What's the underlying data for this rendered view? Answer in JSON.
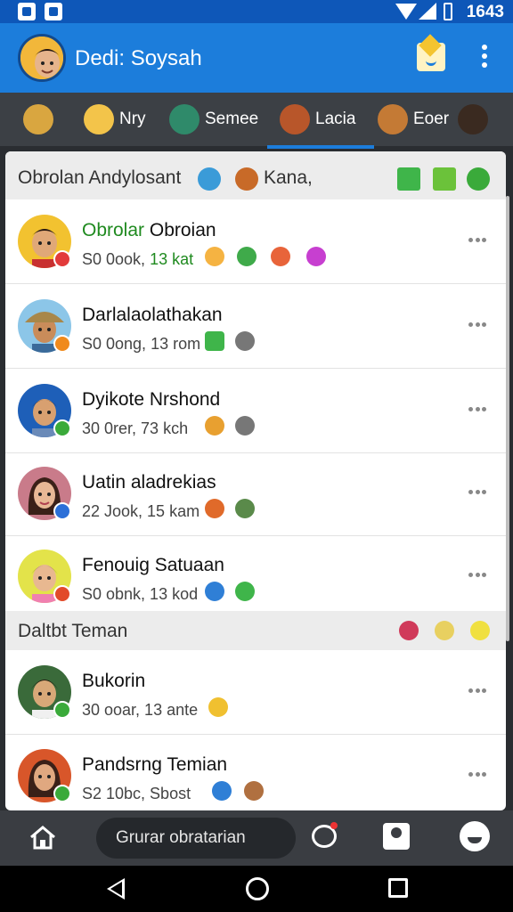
{
  "status_bar": {
    "time": "1643"
  },
  "app_bar": {
    "title": "Dedi: Soysah"
  },
  "stories": [
    {
      "label": "",
      "avatar_color": "#d9a640"
    },
    {
      "label": "Nry",
      "avatar_color": "#f3c44a"
    },
    {
      "label": "Semee",
      "avatar_color": "#2f8a6a"
    },
    {
      "label": "Lacia",
      "avatar_color": "#b8562a"
    },
    {
      "label": "Eoer",
      "avatar_color": "#c47a35"
    },
    {
      "label": "",
      "avatar_color": "#3a2a20"
    }
  ],
  "sections": [
    {
      "title": "Obrolan Andylosant",
      "extra": "Kana,",
      "emoji": [
        "globe-icon",
        "basketball-icon",
        "map-icon",
        "ticket-icon",
        "check-icon"
      ]
    },
    {
      "title": "Daltbt Teman",
      "emoji": [
        "ball-icon",
        "star-icon",
        "ghost-icon"
      ]
    }
  ],
  "chats": [
    {
      "name_hl": "Obrolar",
      "name": " Obroian",
      "sub": "S0 0ook, ",
      "sub_hl": "13 kat",
      "avatar_bg": "#f2c230",
      "badge": "#e23b3b",
      "emoji": [
        "#f5b342",
        "#3faa4a",
        "#e8643a",
        "#c73fd0"
      ]
    },
    {
      "name_hl": "",
      "name": "Darlalaolathakan",
      "sub": "S0 0ong, 13 rom",
      "sub_hl": "",
      "avatar_bg": "#8cc6e8",
      "badge": "#f08a1c",
      "emoji": [
        "#3fb54a",
        "#777777"
      ]
    },
    {
      "name_hl": "",
      "name": "Dyikote Nrshond",
      "sub": "30 0rer, 73 kch",
      "sub_hl": "",
      "avatar_bg": "#1e5fb8",
      "badge": "#3aaa3a",
      "emoji": [
        "#e8a030",
        "#777777"
      ]
    },
    {
      "name_hl": "",
      "name": "Uatin aladrekias",
      "sub": "22 Jook, 15 kam",
      "sub_hl": "",
      "avatar_bg": "#c97b8a",
      "badge": "#2b6fd8",
      "emoji": [
        "#e06a2a",
        "#5a8a4a"
      ]
    },
    {
      "name_hl": "",
      "name": "Fenouig Satuaan",
      "sub": "S0 obnk, 13 kod",
      "sub_hl": "",
      "avatar_bg": "#e3e34a",
      "badge": "#e24a2a",
      "emoji": [
        "#2f7fd6",
        "#3fb54a"
      ]
    },
    {
      "name_hl": "",
      "name": "Bukorin",
      "sub": "30 ooar, 13 ante",
      "sub_hl": "",
      "avatar_bg": "#3a6a3a",
      "badge": "#3aaa3a",
      "emoji": [
        "#f0c030"
      ]
    },
    {
      "name_hl": "",
      "name": "Pandsrng Temian",
      "sub": "S2 10bc, Sbost",
      "sub_hl": "",
      "avatar_bg": "#d8562a",
      "badge": "#3aaa3a",
      "emoji": [
        "#2f7fd6",
        "#b07040"
      ]
    }
  ],
  "bottom_nav": {
    "search_placeholder": "Grurar obratarian"
  }
}
